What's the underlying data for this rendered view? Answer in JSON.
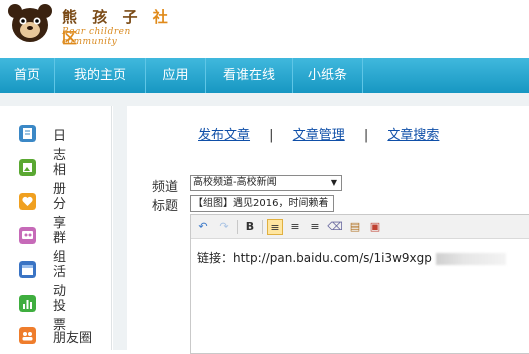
{
  "logo": {
    "name_part1": "熊 孩 子",
    "name_part2": "社 区",
    "tagline": "Bear  children  community"
  },
  "nav": [
    "首页",
    "我的主页",
    "应用",
    "看谁在线",
    "小纸条"
  ],
  "sidebar": [
    {
      "label": "日志",
      "icon": "diary-icon",
      "color": "#3b88c6"
    },
    {
      "label": "相册",
      "icon": "album-icon",
      "color": "#5aa832"
    },
    {
      "label": "分享",
      "icon": "share-icon",
      "color": "#f0a020"
    },
    {
      "label": "群组",
      "icon": "group-icon",
      "color": "#c66ab8"
    },
    {
      "label": "活动",
      "icon": "calendar-icon",
      "color": "#3a74c4"
    },
    {
      "label": "投票",
      "icon": "vote-icon",
      "color": "#3fae3f"
    },
    {
      "label": "朋友圈",
      "icon": "friends-icon",
      "color": "#ef7d2c"
    }
  ],
  "tabs": [
    "发布文章",
    "文章管理",
    "文章搜索"
  ],
  "form": {
    "channel_label": "频道",
    "channel_value": "高校频道-高校新闻",
    "title_label": "标题",
    "title_value": "【组图】遇见2016，时间赖着"
  },
  "editor": {
    "content": "链接：http://pan.baidu.com/s/1i3w9xgp"
  },
  "colors": {
    "nav": "#1fa3cf",
    "link": "#0f4fa8"
  }
}
